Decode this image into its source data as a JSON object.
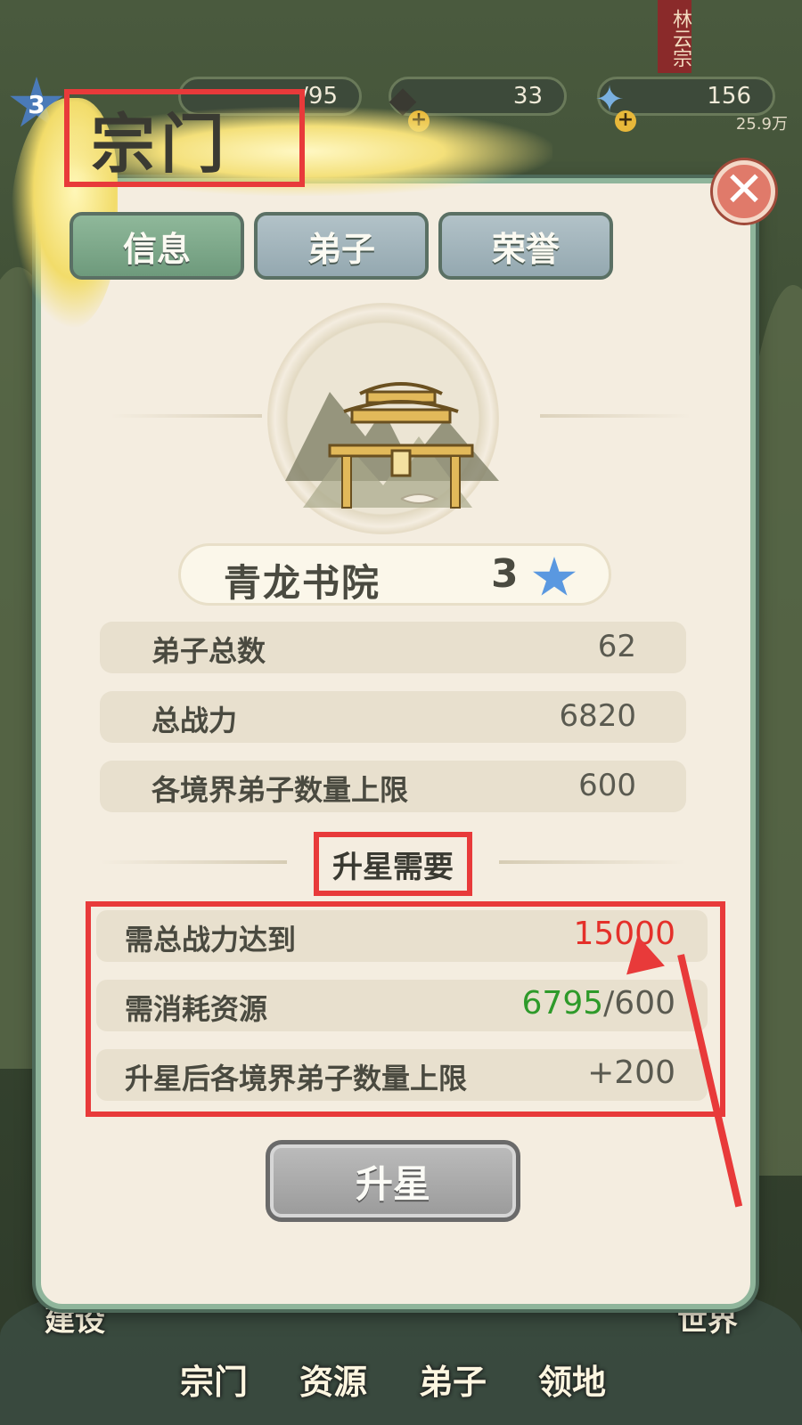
{
  "hud": {
    "level": "3",
    "disciples_count": "/95",
    "resource_1": "33",
    "resource_2": "156",
    "power_text": "25.9万",
    "sect_badge": "林云宗"
  },
  "modal": {
    "title": "宗门",
    "tabs": [
      "信息",
      "弟子",
      "荣誉"
    ],
    "active_tab": 0,
    "sect_name": "青龙书院",
    "star_level": "3",
    "stats": [
      {
        "label": "弟子总数",
        "value": "62"
      },
      {
        "label": "总战力",
        "value": "6820"
      },
      {
        "label": "各境界弟子数量上限",
        "value": "600"
      }
    ],
    "requirements_title": "升星需要",
    "requirements": [
      {
        "label": "需总战力达到",
        "value": "15000"
      },
      {
        "label": "需消耗资源",
        "value_current": "6795",
        "value_required": "/600"
      },
      {
        "label": "升星后各境界弟子数量上限",
        "value": "+200"
      }
    ],
    "upgrade_button": "升星"
  },
  "bottom_nav": [
    "建设",
    "宗门",
    "资源",
    "弟子",
    "领地",
    "世界"
  ],
  "colors": {
    "highlight_red": "#e83a3a",
    "value_red": "#e4302a",
    "value_green": "#2e9a2a",
    "tab_active": "#7ea88a",
    "tab_inactive": "#a0b2ba"
  }
}
